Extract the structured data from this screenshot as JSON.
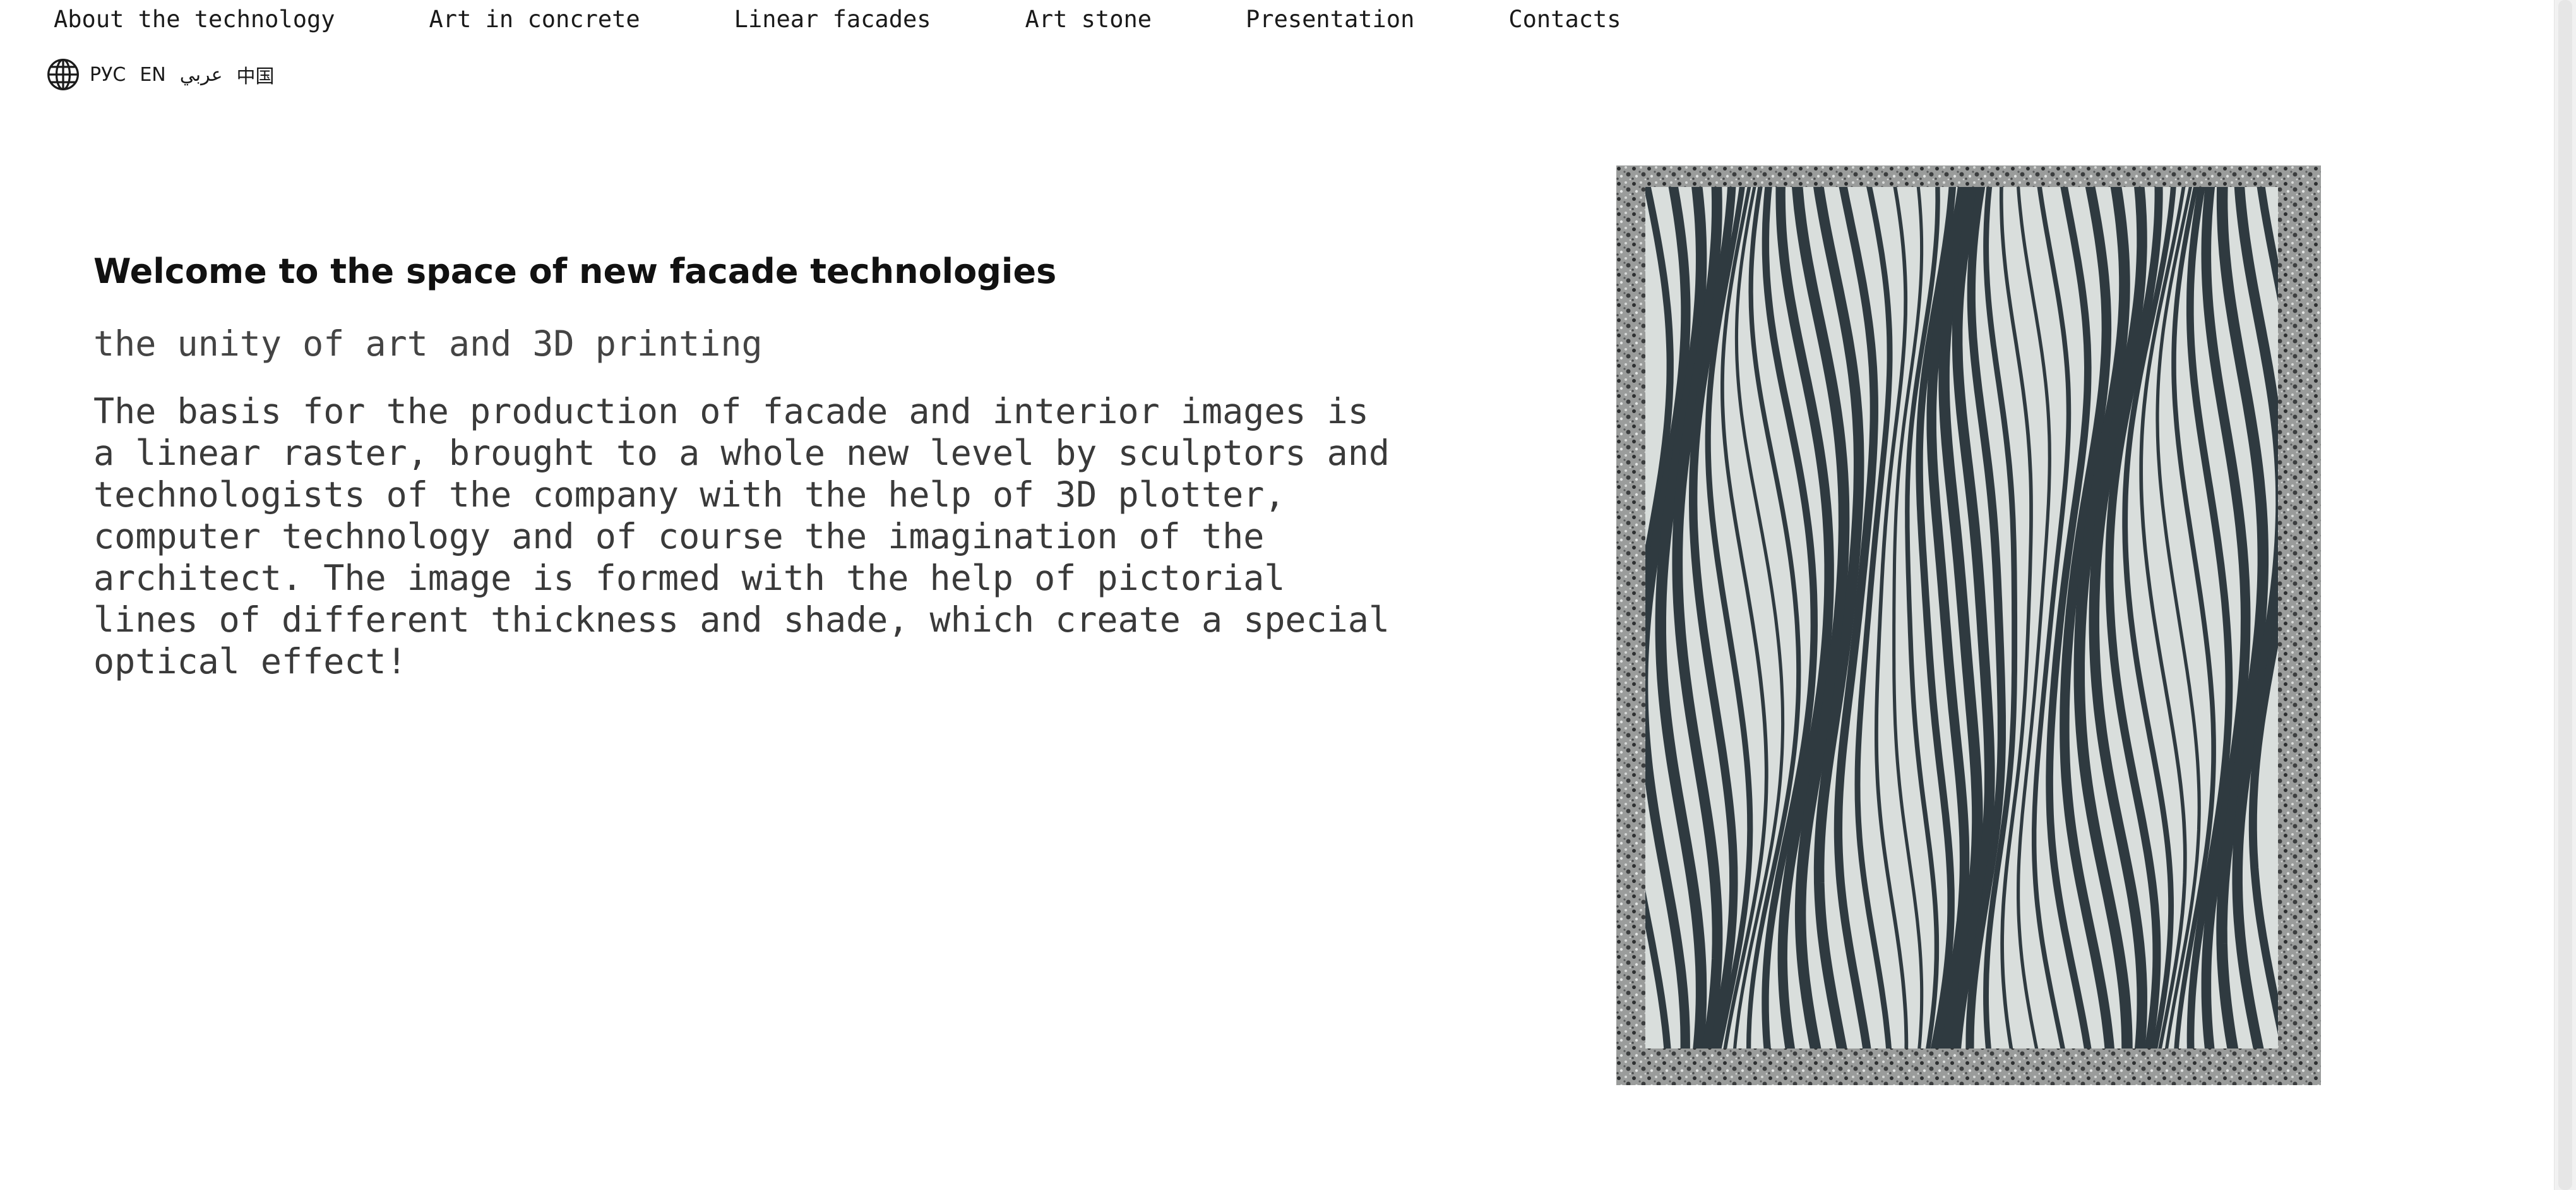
{
  "nav": {
    "items": [
      {
        "label": "About the technology"
      },
      {
        "label": "Art in concrete"
      },
      {
        "label": "Linear facades"
      },
      {
        "label": "Art stone"
      },
      {
        "label": "Presentation"
      },
      {
        "label": "Contacts"
      }
    ]
  },
  "languages": {
    "icon": "globe-icon",
    "items": [
      "РУС",
      "EN",
      "عربي",
      "中国"
    ]
  },
  "hero": {
    "title": "Welcome to the space of new facade technologies",
    "subtitle": "the unity of art and 3D printing",
    "body": "The basis for the production of facade and interior images is a linear raster, brought to a whole new level by sculptors and technologists of the company with the help of 3D plotter, computer technology and of course the imagination of the architect. The image is formed with the help of pictorial lines of different thickness and shade, which create a special optical effect!"
  },
  "artwork": {
    "icon": "linear-raster-concrete-panel-image",
    "colors": {
      "frame": "#8d8f8e",
      "dark_lines": "#2f3a40",
      "light_lines": "#d9dedc"
    }
  }
}
